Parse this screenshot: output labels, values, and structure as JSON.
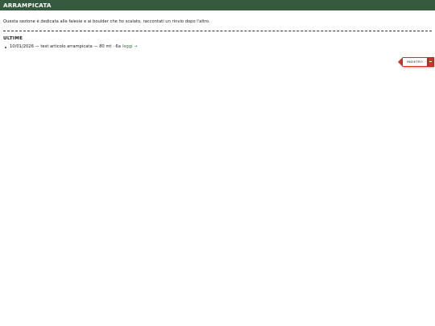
{
  "header": {
    "title": "ARRAMPICATA"
  },
  "intro": {
    "text": "Questa sezione è dedicata alle falesie e ai boulder che ho scalato, raccontati un rinvio dopo l'altro."
  },
  "latest": {
    "heading": "ULTIME",
    "items": [
      {
        "text": "10/01/2026 — test articolo arrampicata — 80 mt · 6a",
        "link_label": "leggi →"
      }
    ]
  },
  "nav": {
    "back_label": "INDIETRO"
  },
  "colors": {
    "header_bg": "#355a3e",
    "link": "#3a6b47",
    "back_accent": "#c0392b"
  }
}
